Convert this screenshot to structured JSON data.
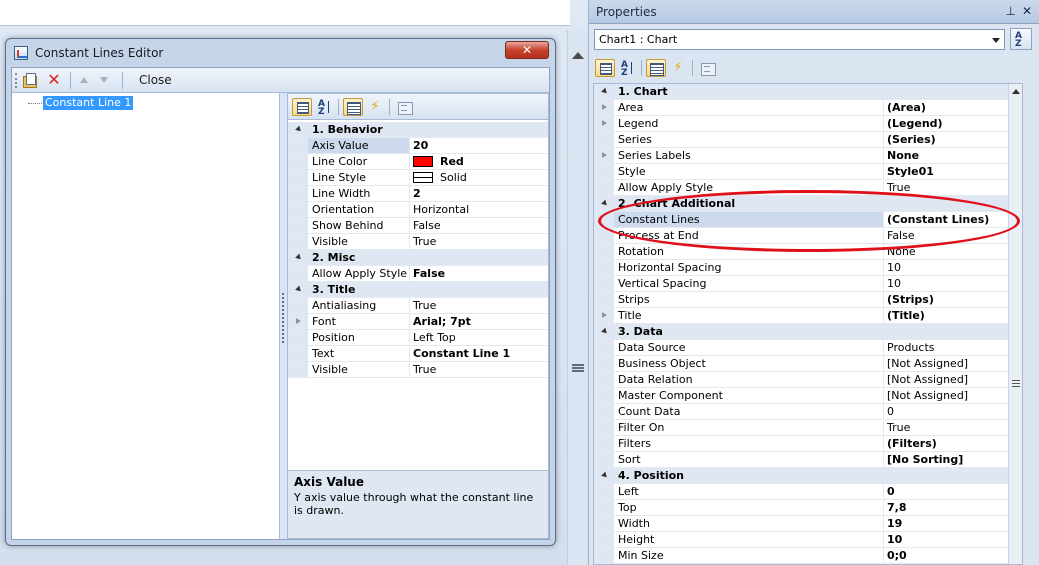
{
  "dialog": {
    "title": "Constant Lines Editor",
    "close_glyph": "✕",
    "toolbar": {
      "close_label": "Close"
    },
    "tree": {
      "items": [
        "Constant Line 1"
      ]
    },
    "grid": {
      "rows": [
        {
          "type": "cat",
          "name": "1. Behavior"
        },
        {
          "type": "prop",
          "name": "Axis Value",
          "value": "20",
          "bold": true,
          "selected": true
        },
        {
          "type": "prop",
          "name": "Line Color",
          "value": "Red",
          "bold": true,
          "swatch": "#ff0000"
        },
        {
          "type": "prop",
          "name": "Line Style",
          "value": "Solid",
          "bold": false,
          "swatch": "line"
        },
        {
          "type": "prop",
          "name": "Line Width",
          "value": "2",
          "bold": true
        },
        {
          "type": "prop",
          "name": "Orientation",
          "value": "Horizontal",
          "bold": false
        },
        {
          "type": "prop",
          "name": "Show Behind",
          "value": "False",
          "bold": false
        },
        {
          "type": "prop",
          "name": "Visible",
          "value": "True",
          "bold": false
        },
        {
          "type": "cat",
          "name": "2. Misc"
        },
        {
          "type": "prop",
          "name": "Allow Apply Style",
          "value": "False",
          "bold": true
        },
        {
          "type": "cat",
          "name": "3. Title"
        },
        {
          "type": "prop",
          "name": "Antialiasing",
          "value": "True",
          "bold": false
        },
        {
          "type": "prop",
          "name": "Font",
          "value": "Arial; 7pt",
          "bold": true,
          "expandable": true
        },
        {
          "type": "prop",
          "name": "Position",
          "value": "Left Top",
          "bold": false
        },
        {
          "type": "prop",
          "name": "Text",
          "value": "Constant Line 1",
          "bold": true
        },
        {
          "type": "prop",
          "name": "Visible",
          "value": "True",
          "bold": false
        }
      ]
    },
    "description": {
      "title": "Axis Value",
      "text": "Y axis value through what the constant line is drawn."
    }
  },
  "properties": {
    "title": "Properties",
    "pin_glyph": "⊥",
    "close_glyph": "✕",
    "object_selector": "Chart1 : Chart",
    "rows": [
      {
        "type": "cat",
        "name": "1. Chart"
      },
      {
        "type": "prop",
        "name": "Area",
        "value": "(Area)",
        "bold": true,
        "expandable": true
      },
      {
        "type": "prop",
        "name": "Legend",
        "value": "(Legend)",
        "bold": true,
        "expandable": true
      },
      {
        "type": "prop",
        "name": "Series",
        "value": "(Series)",
        "bold": true
      },
      {
        "type": "prop",
        "name": "Series Labels",
        "value": "None",
        "bold": true,
        "expandable": true
      },
      {
        "type": "prop",
        "name": "Style",
        "value": "Style01",
        "bold": true
      },
      {
        "type": "prop",
        "name": "Allow Apply Style",
        "value": "True",
        "bold": false
      },
      {
        "type": "cat",
        "name": "2. Chart  Additional"
      },
      {
        "type": "prop",
        "name": "Constant Lines",
        "value": "(Constant Lines)",
        "bold": true,
        "selected": true
      },
      {
        "type": "prop",
        "name": "Process at End",
        "value": "False",
        "bold": false
      },
      {
        "type": "prop",
        "name": "Rotation",
        "value": "None",
        "bold": false
      },
      {
        "type": "prop",
        "name": "Horizontal Spacing",
        "value": "10",
        "bold": false
      },
      {
        "type": "prop",
        "name": "Vertical Spacing",
        "value": "10",
        "bold": false
      },
      {
        "type": "prop",
        "name": "Strips",
        "value": "(Strips)",
        "bold": true
      },
      {
        "type": "prop",
        "name": "Title",
        "value": "(Title)",
        "bold": true,
        "expandable": true
      },
      {
        "type": "cat",
        "name": "3. Data"
      },
      {
        "type": "prop",
        "name": "Data Source",
        "value": "Products",
        "bold": false
      },
      {
        "type": "prop",
        "name": "Business Object",
        "value": "[Not Assigned]",
        "bold": false
      },
      {
        "type": "prop",
        "name": "Data Relation",
        "value": "[Not Assigned]",
        "bold": false
      },
      {
        "type": "prop",
        "name": "Master Component",
        "value": "[Not Assigned]",
        "bold": false
      },
      {
        "type": "prop",
        "name": "Count Data",
        "value": "0",
        "bold": false
      },
      {
        "type": "prop",
        "name": "Filter On",
        "value": "True",
        "bold": false
      },
      {
        "type": "prop",
        "name": "Filters",
        "value": "(Filters)",
        "bold": true
      },
      {
        "type": "prop",
        "name": "Sort",
        "value": "[No Sorting]",
        "bold": true
      },
      {
        "type": "cat",
        "name": "4. Position"
      },
      {
        "type": "prop",
        "name": "Left",
        "value": "0",
        "bold": true
      },
      {
        "type": "prop",
        "name": "Top",
        "value": "7,8",
        "bold": true
      },
      {
        "type": "prop",
        "name": "Width",
        "value": "19",
        "bold": true
      },
      {
        "type": "prop",
        "name": "Height",
        "value": "10",
        "bold": true
      },
      {
        "type": "prop",
        "name": "Min Size",
        "value": "0;0",
        "bold": true
      }
    ]
  },
  "icons": {
    "delete": "✕",
    "events": "⚡",
    "sort_az": "A Z"
  },
  "colors": {
    "annotation": "#e0101a",
    "selection": "#3399ff",
    "line_color_swatch": "#ff0000"
  }
}
